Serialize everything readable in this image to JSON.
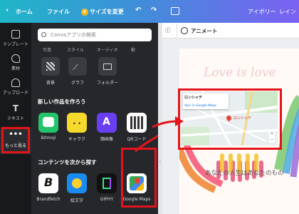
{
  "topbar": {
    "home": "ホーム",
    "file": "ファイル",
    "resize": "サイズを変更",
    "color_name": "アイボリー",
    "share": "レイン"
  },
  "sidebar": {
    "items": [
      {
        "label": "テンプレート"
      },
      {
        "label": "素材"
      },
      {
        "label": "アップロード"
      },
      {
        "label": "テキスト"
      },
      {
        "label": "もっと見る"
      }
    ]
  },
  "panel": {
    "search_placeholder": "Canvaアプリの検索",
    "categories": [
      "写真",
      "スタイル",
      "オーディオ",
      "動"
    ],
    "tools": [
      {
        "label": "背景"
      },
      {
        "label": "グラフ"
      },
      {
        "label": "フォルダー"
      }
    ],
    "create_title": "新しい作品を作ろう",
    "create_apps": [
      {
        "label": "Bitmoji"
      },
      {
        "label": "キャラク"
      },
      {
        "label": "顔画像"
      },
      {
        "label": "QRコード"
      }
    ],
    "explore_title": "コンテンツを次から探す",
    "explore_apps": [
      {
        "label": "Brandfetch"
      },
      {
        "label": "絵文字"
      },
      {
        "label": "GIPHY"
      },
      {
        "label": "Google Maps"
      }
    ]
  },
  "toolbar": {
    "animate": "アニメート",
    "info_icon": "ⓘ"
  },
  "canvas": {
    "quote": "あなたの人生はあなたのもの",
    "script_text": "Love is love",
    "map_place": "ロンシャテ",
    "map_pin_label": "ロンシャテ",
    "map_link": "Apri in Google Maps"
  },
  "colors": {
    "highlight": "#e3141c",
    "sidebar_bg": "#18191b",
    "panel_bg": "#25272b"
  }
}
